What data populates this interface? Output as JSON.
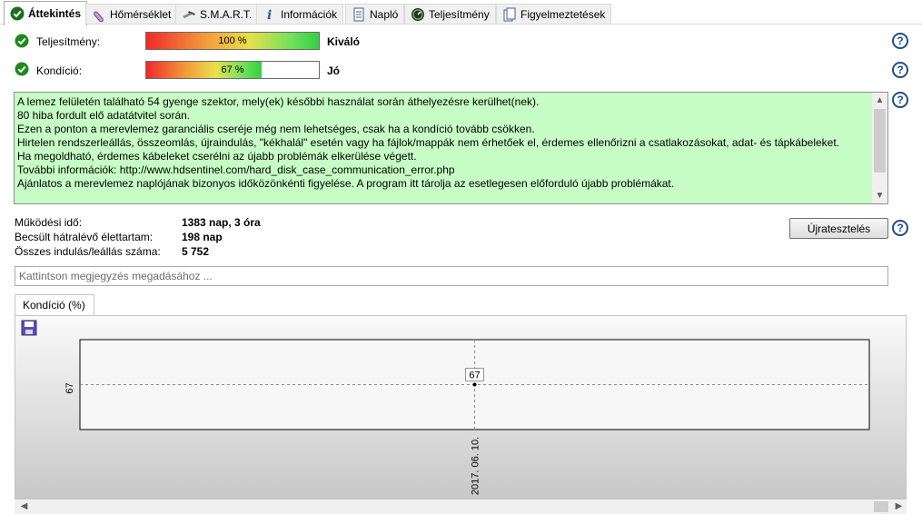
{
  "tabs": [
    {
      "label": "Áttekintés",
      "icon": "check-circle-icon",
      "active": true
    },
    {
      "label": "Hőmérséklet",
      "icon": "thermometer-icon"
    },
    {
      "label": "S.M.A.R.T.",
      "icon": "tools-icon"
    },
    {
      "label": "Információk",
      "icon": "info-icon"
    },
    {
      "label": "Napló",
      "icon": "log-document-icon"
    },
    {
      "label": "Teljesítmény",
      "icon": "speedometer-icon"
    },
    {
      "label": "Figyelmeztetések",
      "icon": "alerts-document-icon"
    }
  ],
  "performance": {
    "label": "Teljesítmény:",
    "percent_text": "100 %",
    "level": 1.0,
    "rating": "Kiváló"
  },
  "condition": {
    "label": "Kondíció:",
    "percent_text": "67 %",
    "level": 0.67,
    "rating": "Jó"
  },
  "message_lines": [
    "A lemez felületén található 54 gyenge szektor, mely(ek) későbbi használat során áthelyezésre kerülhet(nek).",
    "80 hiba fordult elő adatátvitel során.",
    "Ezen a ponton a merevlemez garanciális cseréje még nem lehetséges, csak ha a kondíció tovább csökken.",
    "Hirtelen rendszerleállás, összeomlás, újraindulás, \"kékhalál\" esetén vagy ha fájlok/mappák nem érhetőek el, érdemes ellenőrizni a csatlakozásokat, adat- és tápkábeleket.",
    "Ha megoldható, érdemes kábeleket cserélni az újabb problémák elkerülése végett.",
    "További információk: http://www.hdsentinel.com/hard_disk_case_communication_error.php",
    "Ajánlatos a merevlemez naplójának bizonyos időközönkénti figyelése. A program itt tárolja az esetlegesen előforduló újabb problémákat."
  ],
  "stats": {
    "uptime_label": "Működési idő:",
    "uptime_value": "1383 nap, 3 óra",
    "lifetime_label": "Becsült hátralévő élettartam:",
    "lifetime_value": "198 nap",
    "startstop_label": "Összes indulás/leállás száma:",
    "startstop_value": "5 752"
  },
  "retest_button": "Újratesztelés",
  "note_placeholder": "Kattintson megjegyzés megadásához ...",
  "chart_tab": "Kondíció  (%)",
  "colors": {
    "message_bg": "#c7fec5",
    "help_blue": "#1f4e8a",
    "check_green": "#1e8a1e"
  },
  "chart_data": {
    "type": "line",
    "x": [
      "2017. 06. 10."
    ],
    "series": [
      {
        "values": [
          67
        ]
      }
    ],
    "ylabel": "",
    "y_tick_labels": [
      "67"
    ],
    "data_labels": [
      "67"
    ],
    "grid": true
  }
}
